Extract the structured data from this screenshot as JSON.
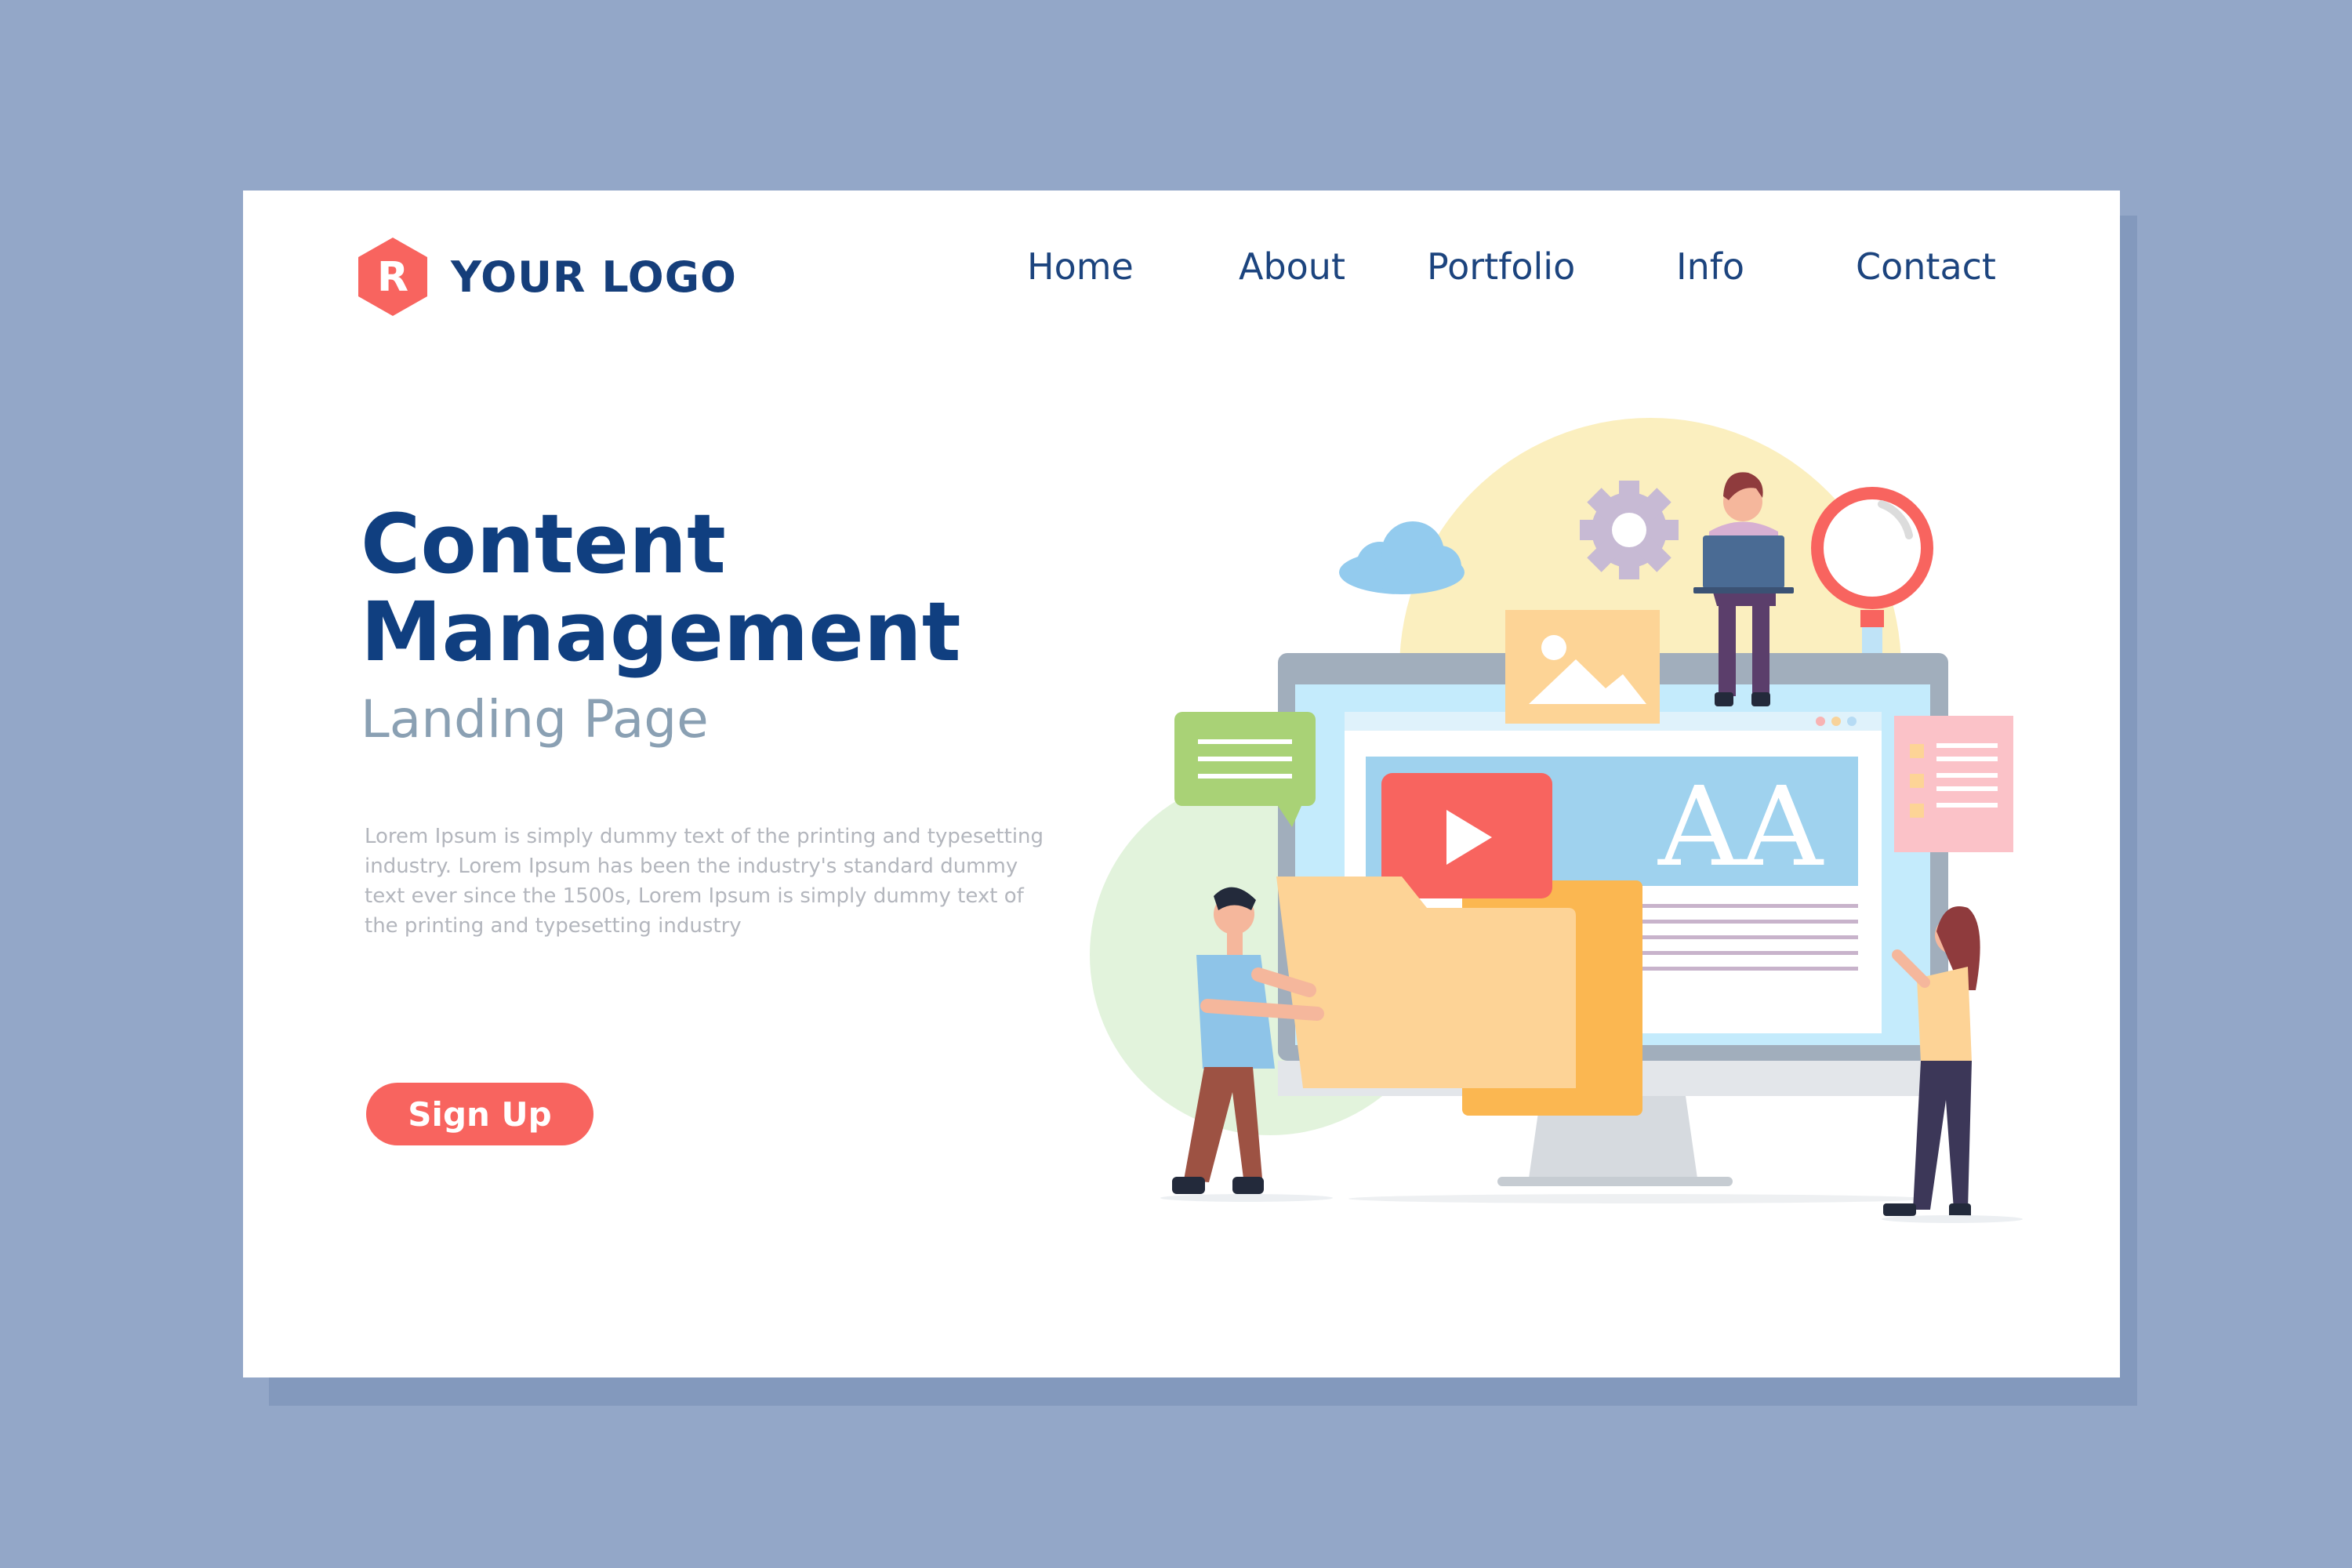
{
  "logo": {
    "badge_letter": "R",
    "text": "YOUR LOGO",
    "badge_color": "#f8645f"
  },
  "nav": {
    "items": [
      "Home",
      "About",
      "Portfolio",
      "Info",
      "Contact"
    ]
  },
  "hero": {
    "title_line1": "Content",
    "title_line2": "Management",
    "subtitle": "Landing Page",
    "body": "Lorem Ipsum is simply dummy text of the printing and typesetting industry. Lorem Ipsum has been the industry's standard dummy text ever since the 1500s, Lorem Ipsum is simply dummy text of the printing and typesetting industry",
    "cta_label": "Sign Up"
  },
  "illustration": {
    "type_sample": "AA"
  },
  "colors": {
    "background": "#93a7c8",
    "primary_text": "#103f80",
    "accent": "#f8645f",
    "subtitle": "#8aa0b3"
  },
  "icons": [
    "logo-badge-icon",
    "cloud-icon",
    "gear-icon",
    "image-icon",
    "magnifier-icon",
    "chat-bubble-icon",
    "play-icon",
    "folder-icon",
    "checklist-icon"
  ]
}
